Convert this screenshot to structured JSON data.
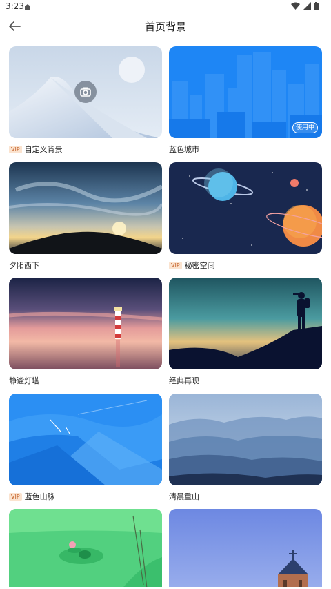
{
  "status": {
    "time": "3:23"
  },
  "header": {
    "title": "首页背景"
  },
  "icons": {
    "back": "arrow-left-icon",
    "camera": "camera-icon",
    "wifi": "wifi-icon",
    "signal": "signal-icon",
    "battery": "battery-icon"
  },
  "vip_label": "VIP",
  "using_label": "使用中",
  "items": [
    {
      "name": "自定义背景",
      "vip": true
    },
    {
      "name": "蓝色城市",
      "vip": false,
      "in_use": true
    },
    {
      "name": "夕阳西下",
      "vip": false
    },
    {
      "name": "秘密空间",
      "vip": true
    },
    {
      "name": "静谧灯塔",
      "vip": false
    },
    {
      "name": "经典再现",
      "vip": false
    },
    {
      "name": "蓝色山脉",
      "vip": true
    },
    {
      "name": "清晨重山",
      "vip": false
    },
    {
      "name": "",
      "vip": false
    },
    {
      "name": "",
      "vip": false
    }
  ]
}
